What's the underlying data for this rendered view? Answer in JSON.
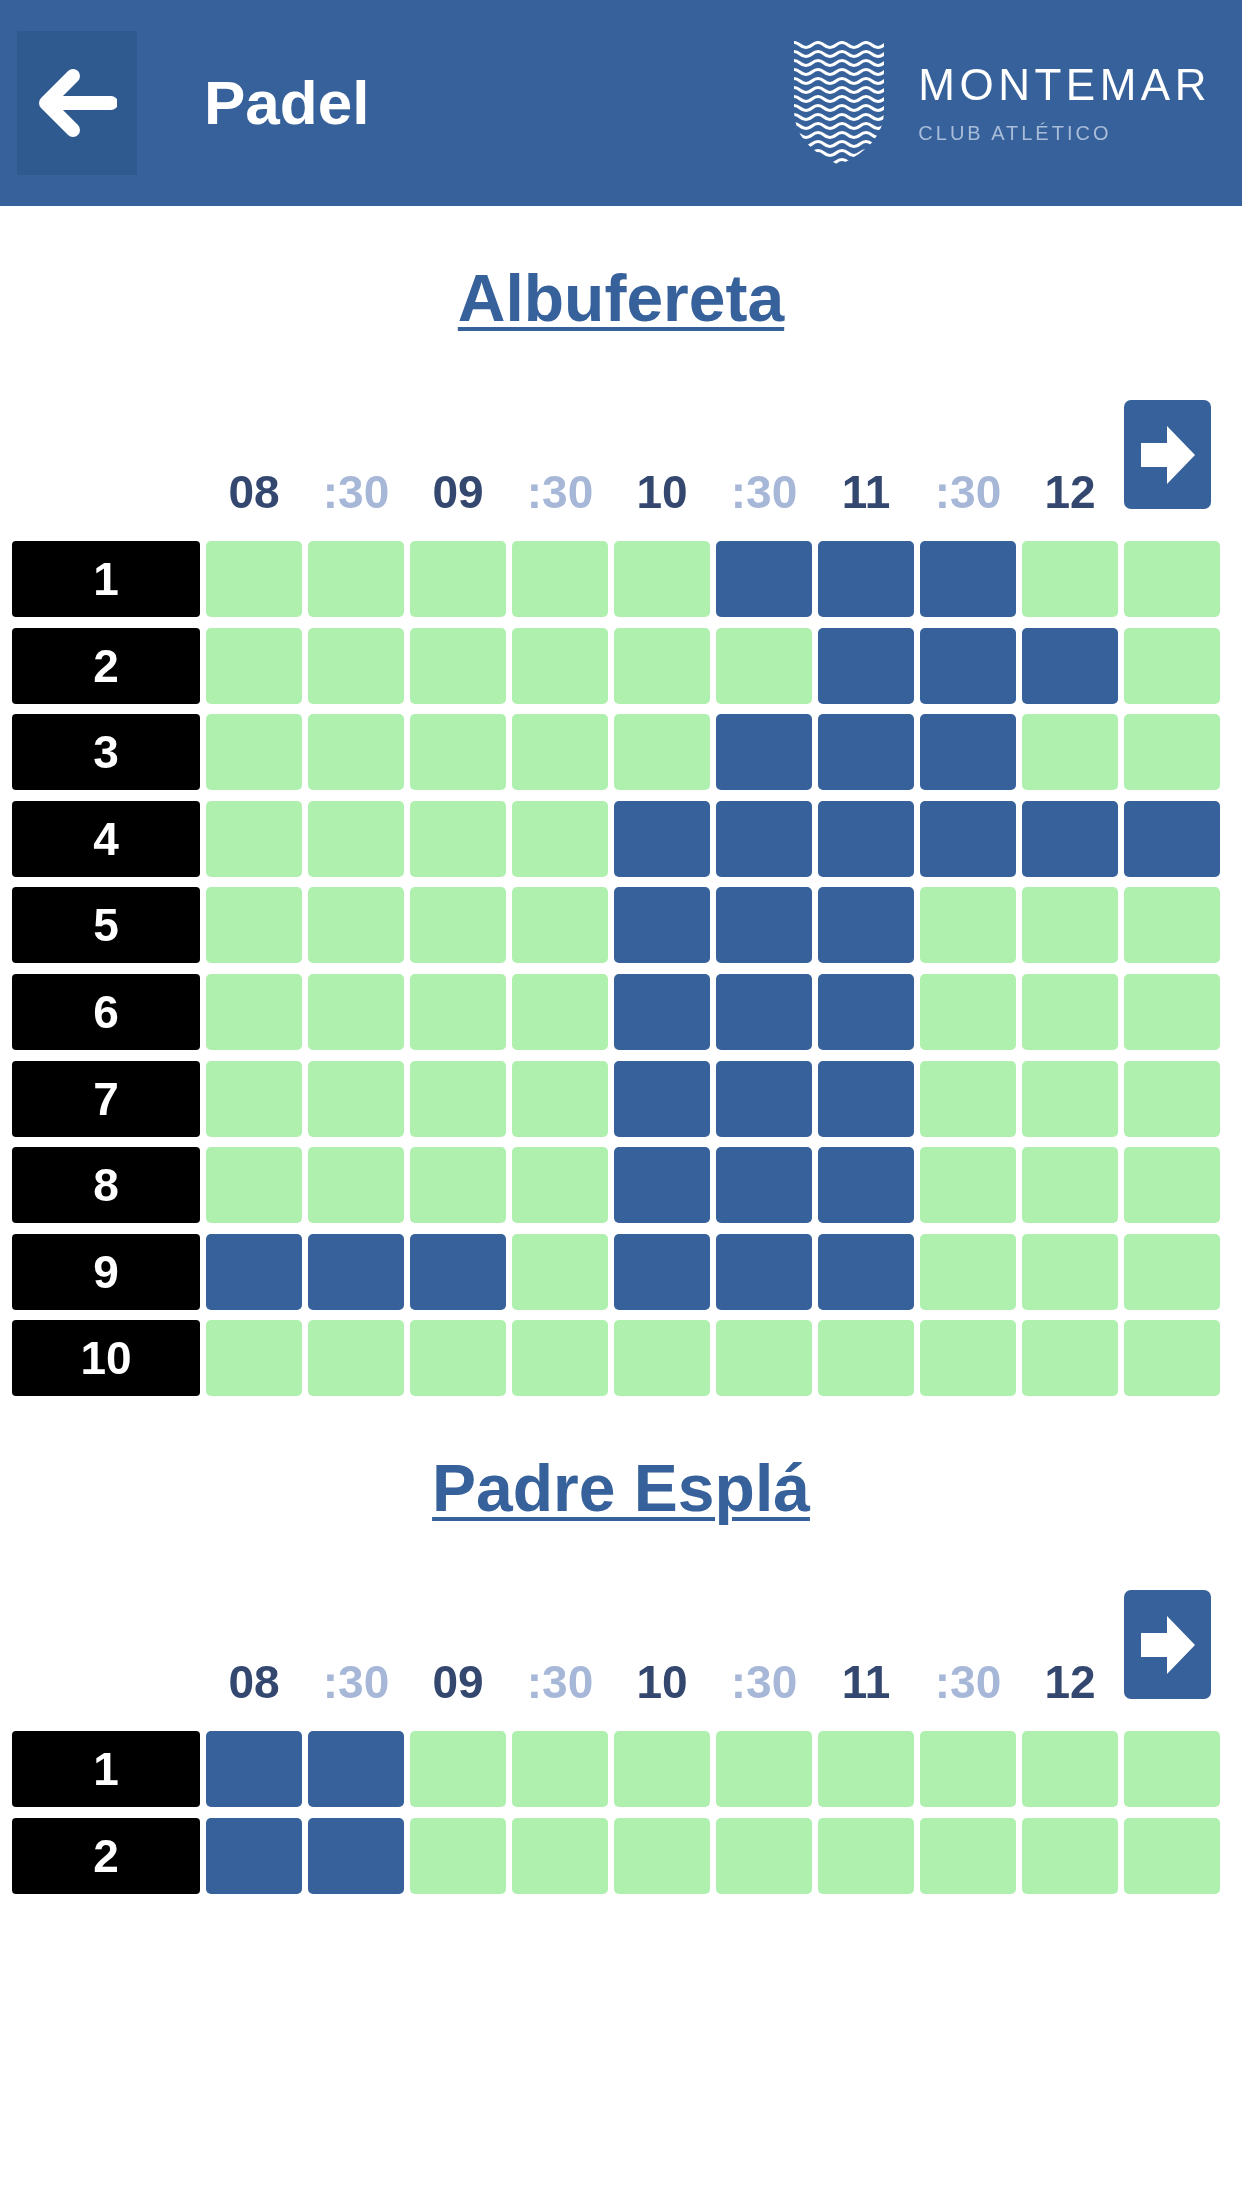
{
  "header": {
    "title": "Padel",
    "brand": {
      "name": "MONTEMAR",
      "tagline": "CLUB ATLÉTICO"
    }
  },
  "venues": [
    {
      "name": "Albufereta",
      "times": [
        {
          "label": "08",
          "kind": "hour"
        },
        {
          "label": ":30",
          "kind": "half"
        },
        {
          "label": "09",
          "kind": "hour"
        },
        {
          "label": ":30",
          "kind": "half"
        },
        {
          "label": "10",
          "kind": "hour"
        },
        {
          "label": ":30",
          "kind": "half"
        },
        {
          "label": "11",
          "kind": "hour"
        },
        {
          "label": ":30",
          "kind": "half"
        },
        {
          "label": "12",
          "kind": "hour"
        }
      ],
      "courts": [
        {
          "label": "1",
          "slots": [
            {
              "booked": false
            },
            {
              "booked": false
            },
            {
              "booked": false
            },
            {
              "booked": false
            },
            {
              "booked": false
            },
            {
              "booked": true
            },
            {
              "booked": true
            },
            {
              "booked": true
            },
            {
              "booked": false
            },
            {
              "booked": false
            }
          ]
        },
        {
          "label": "2",
          "slots": [
            {
              "booked": false
            },
            {
              "booked": false
            },
            {
              "booked": false
            },
            {
              "booked": false
            },
            {
              "booked": false
            },
            {
              "booked": false
            },
            {
              "booked": true
            },
            {
              "booked": true
            },
            {
              "booked": true
            },
            {
              "booked": false
            }
          ]
        },
        {
          "label": "3",
          "slots": [
            {
              "booked": false
            },
            {
              "booked": false
            },
            {
              "booked": false
            },
            {
              "booked": false
            },
            {
              "booked": false
            },
            {
              "booked": true
            },
            {
              "booked": true
            },
            {
              "booked": true
            },
            {
              "booked": false
            },
            {
              "booked": false
            }
          ]
        },
        {
          "label": "4",
          "slots": [
            {
              "booked": false
            },
            {
              "booked": false
            },
            {
              "booked": false
            },
            {
              "booked": false
            },
            {
              "booked": true
            },
            {
              "booked": true
            },
            {
              "booked": true
            },
            {
              "booked": true
            },
            {
              "booked": true
            },
            {
              "booked": true
            }
          ]
        },
        {
          "label": "5",
          "slots": [
            {
              "booked": false
            },
            {
              "booked": false
            },
            {
              "booked": false
            },
            {
              "booked": false
            },
            {
              "booked": true
            },
            {
              "booked": true
            },
            {
              "booked": true
            },
            {
              "booked": false
            },
            {
              "booked": false
            },
            {
              "booked": false
            }
          ]
        },
        {
          "label": "6",
          "slots": [
            {
              "booked": false
            },
            {
              "booked": false
            },
            {
              "booked": false
            },
            {
              "booked": false
            },
            {
              "booked": true
            },
            {
              "booked": true
            },
            {
              "booked": true
            },
            {
              "booked": false
            },
            {
              "booked": false
            },
            {
              "booked": false
            }
          ]
        },
        {
          "label": "7",
          "slots": [
            {
              "booked": false
            },
            {
              "booked": false
            },
            {
              "booked": false
            },
            {
              "booked": false
            },
            {
              "booked": true
            },
            {
              "booked": true
            },
            {
              "booked": true
            },
            {
              "booked": false
            },
            {
              "booked": false
            },
            {
              "booked": false
            }
          ]
        },
        {
          "label": "8",
          "slots": [
            {
              "booked": false
            },
            {
              "booked": false
            },
            {
              "booked": false
            },
            {
              "booked": false
            },
            {
              "booked": true
            },
            {
              "booked": true
            },
            {
              "booked": true
            },
            {
              "booked": false
            },
            {
              "booked": false
            },
            {
              "booked": false
            }
          ]
        },
        {
          "label": "9",
          "slots": [
            {
              "booked": true
            },
            {
              "booked": true
            },
            {
              "booked": true
            },
            {
              "booked": false
            },
            {
              "booked": true
            },
            {
              "booked": true
            },
            {
              "booked": true
            },
            {
              "booked": false
            },
            {
              "booked": false
            },
            {
              "booked": false
            }
          ]
        },
        {
          "label": "10",
          "slots": [
            {
              "booked": false
            },
            {
              "booked": false
            },
            {
              "booked": false
            },
            {
              "booked": false
            },
            {
              "booked": false
            },
            {
              "booked": false
            },
            {
              "booked": false
            },
            {
              "booked": false
            },
            {
              "booked": false
            },
            {
              "booked": false
            }
          ]
        }
      ]
    },
    {
      "name": "Padre Esplá",
      "times": [
        {
          "label": "08",
          "kind": "hour"
        },
        {
          "label": ":30",
          "kind": "half"
        },
        {
          "label": "09",
          "kind": "hour"
        },
        {
          "label": ":30",
          "kind": "half"
        },
        {
          "label": "10",
          "kind": "hour"
        },
        {
          "label": ":30",
          "kind": "half"
        },
        {
          "label": "11",
          "kind": "hour"
        },
        {
          "label": ":30",
          "kind": "half"
        },
        {
          "label": "12",
          "kind": "hour"
        }
      ],
      "courts": [
        {
          "label": "1",
          "slots": [
            {
              "booked": true
            },
            {
              "booked": true
            },
            {
              "booked": false
            },
            {
              "booked": false
            },
            {
              "booked": false
            },
            {
              "booked": false
            },
            {
              "booked": false
            },
            {
              "booked": false
            },
            {
              "booked": false
            },
            {
              "booked": false
            }
          ]
        },
        {
          "label": "2",
          "slots": [
            {
              "booked": true
            },
            {
              "booked": true
            },
            {
              "booked": false
            },
            {
              "booked": false
            },
            {
              "booked": false
            },
            {
              "booked": false
            },
            {
              "booked": false
            },
            {
              "booked": false
            },
            {
              "booked": false
            },
            {
              "booked": false
            }
          ]
        }
      ]
    }
  ]
}
